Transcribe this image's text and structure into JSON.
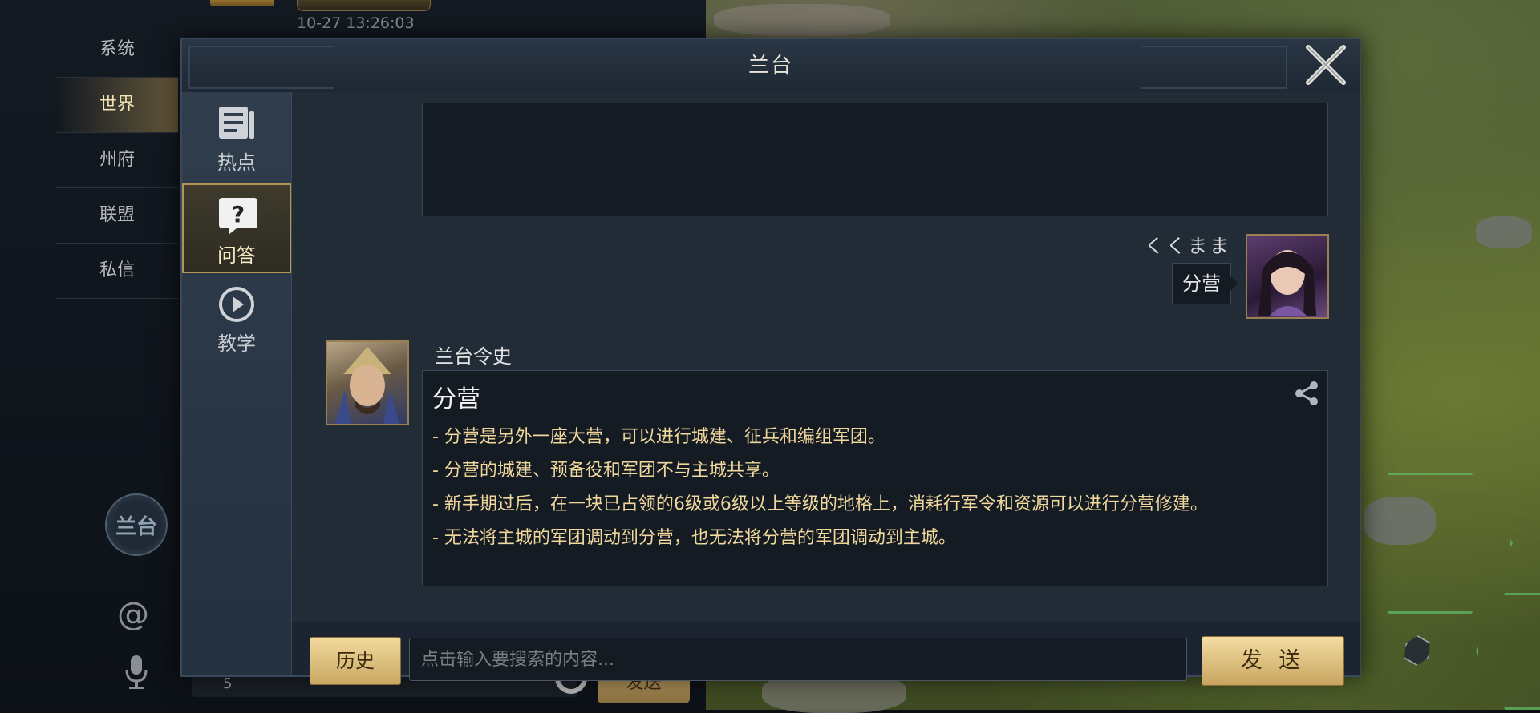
{
  "background_chat": {
    "timestamp": "10-27 13:26:03",
    "channels": [
      {
        "label": "系统",
        "active": false
      },
      {
        "label": "世界",
        "active": true
      },
      {
        "label": "州府",
        "active": false
      },
      {
        "label": "联盟",
        "active": false
      },
      {
        "label": "私信",
        "active": false
      }
    ],
    "emblem_label": "兰台",
    "at_symbol": "@",
    "input_count": "5",
    "send_label": "发送"
  },
  "modal": {
    "title": "兰台",
    "nav": [
      {
        "label": "热点",
        "icon": "document-icon",
        "active": false
      },
      {
        "label": "问答",
        "icon": "question-icon",
        "active": true
      },
      {
        "label": "教学",
        "icon": "play-icon",
        "active": false
      }
    ],
    "user_message": {
      "name": "くくまま",
      "text": "分营"
    },
    "bot_message": {
      "name": "兰台令史",
      "title": "分营",
      "lines": [
        "- 分营是另外一座大营，可以进行城建、征兵和编组军团。",
        "- 分营的城建、预备役和军团不与主城共享。",
        "- 新手期过后，在一块已占领的6级或6级以上等级的地格上，消耗行军令和资源可以进行分营修建。",
        "- 无法将主城的军团调动到分营，也无法将分营的军团调动到主城。"
      ]
    },
    "bottom": {
      "history_label": "历史",
      "search_placeholder": "点击输入要搜索的内容...",
      "send_label": "发 送"
    }
  },
  "colors": {
    "accent_gold": "#c9a862",
    "bot_text": "#f0d79c",
    "panel_bg": "#1b2430"
  }
}
